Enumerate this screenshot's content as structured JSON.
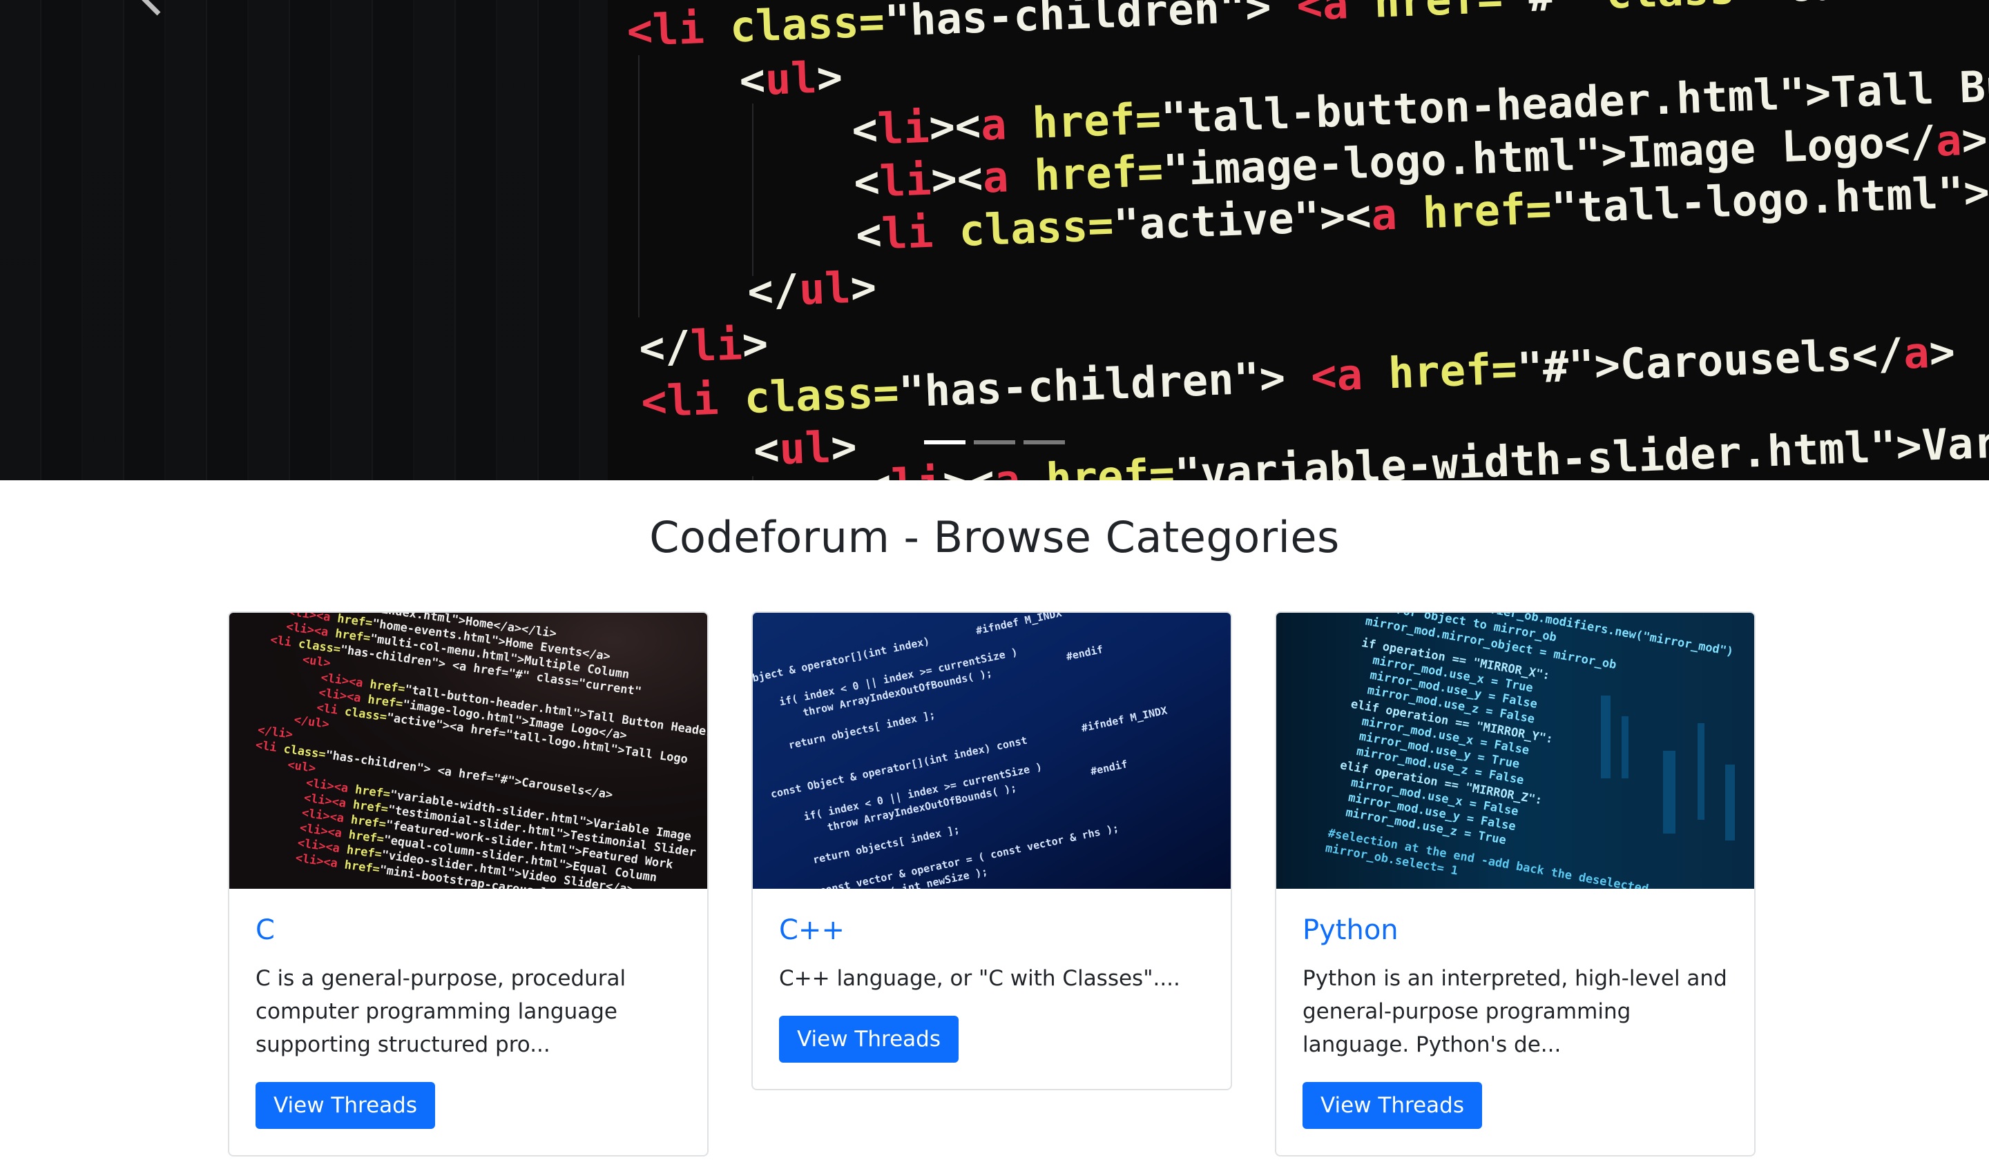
{
  "carousel": {
    "slides_count": 3,
    "active_index": 0,
    "code_lines": [
      "<li class=\"has-children\"> <a href=\"#\" class=\"current",
      "<ul>",
      "<li><a href=\"tall-button-header.html\">Tall But",
      "<li><a href=\"image-logo.html\">Image Logo</a></",
      "<li class=\"active\"><a href=\"tall-logo.html\">Ta",
      "</ul>",
      "</li>",
      "<li class=\"has-children\"> <a href=\"#\">Carousels</a>",
      "<ul>",
      "<li><a href=\"variable-width-slider.html\">Variab",
      "<li><a href=\"testimonial-slider.html\">Testimoni"
    ]
  },
  "page": {
    "heading": "Codeforum - Browse Categories"
  },
  "categories": [
    {
      "title": "C",
      "description": "C is a general-purpose, procedural computer programming language supporting structured pro...",
      "button": "View Threads"
    },
    {
      "title": "C++",
      "description": "C++ language, or \"C with Classes\"....",
      "button": "View Threads"
    },
    {
      "title": "Python",
      "description": "Python is an interpreted, high-level and general-purpose programming language. Python's de...",
      "button": "View Threads"
    }
  ],
  "colors": {
    "primary": "#0d6efd",
    "tag": "#e8334a",
    "attr": "#e6e86a",
    "string": "#f2f2e6",
    "card_border": "#dfe2e5"
  },
  "icons": {
    "carousel_prev": "chevron-left-icon"
  }
}
